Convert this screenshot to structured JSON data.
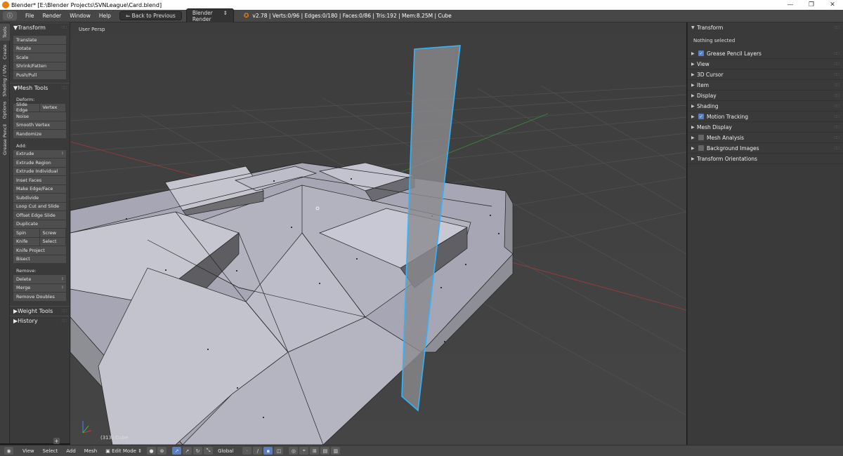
{
  "window": {
    "title": "Blender* [E:\\Blender Projects\\SVNLeague\\Card.blend]",
    "controls": [
      "—",
      "❐",
      "✕"
    ]
  },
  "info_header": {
    "menus": [
      "File",
      "Render",
      "Window",
      "Help"
    ],
    "back_button": "Back to Previous",
    "render_engine": "Blender Render",
    "stats": "v2.78 | Verts:0/96 | Edges:0/180 | Faces:0/86 | Tris:192 | Mem:8.25M | Cube"
  },
  "vertical_tabs": [
    "Tools",
    "Create",
    "Shading / UVs",
    "Options",
    "Grease Pencil"
  ],
  "tool_shelf": {
    "transform": {
      "title": "Transform",
      "buttons": [
        "Translate",
        "Rotate",
        "Scale",
        "Shrink/Fatten",
        "Push/Pull"
      ]
    },
    "mesh_tools": {
      "title": "Mesh Tools",
      "deform_label": "Deform:",
      "slide_edge": "Slide Edge",
      "vertex": "Vertex",
      "noise": "Noise",
      "smooth_vertex": "Smooth Vertex",
      "randomize": "Randomize",
      "add_label": "Add:",
      "extrude": "Extrude",
      "extrude_region": "Extrude Region",
      "extrude_individual": "Extrude Individual",
      "inset_faces": "Inset Faces",
      "make_edge_face": "Make Edge/Face",
      "subdivide": "Subdivide",
      "loop_cut": "Loop Cut and Slide",
      "offset_edge_slide": "Offset Edge Slide",
      "duplicate": "Duplicate",
      "spin": "Spin",
      "screw": "Screw",
      "knife": "Knife",
      "select": "Select",
      "knife_project": "Knife Project",
      "bisect": "Bisect",
      "remove_label": "Remove:",
      "delete": "Delete",
      "merge": "Merge",
      "remove_doubles": "Remove Doubles"
    },
    "weight_tools": "Weight Tools",
    "history": "History"
  },
  "viewport": {
    "view_name": "User Persp",
    "object_info": "(313) Cube",
    "selection_color": "#2fb5ff"
  },
  "properties": {
    "transform_title": "Transform",
    "nothing_selected": "Nothing selected",
    "panels": [
      {
        "label": "Grease Pencil Layers",
        "checkbox": true
      },
      {
        "label": "View"
      },
      {
        "label": "3D Cursor"
      },
      {
        "label": "Item"
      },
      {
        "label": "Display"
      },
      {
        "label": "Shading"
      },
      {
        "label": "Motion Tracking",
        "checkbox": true
      },
      {
        "label": "Mesh Display"
      },
      {
        "label": "Mesh Analysis",
        "checkbox": false
      },
      {
        "label": "Background Images",
        "checkbox": false
      },
      {
        "label": "Transform Orientations"
      }
    ]
  },
  "bottom_header": {
    "menus": [
      "View",
      "Select",
      "Add",
      "Mesh"
    ],
    "mode": "Edit Mode",
    "orientation": "Global"
  }
}
